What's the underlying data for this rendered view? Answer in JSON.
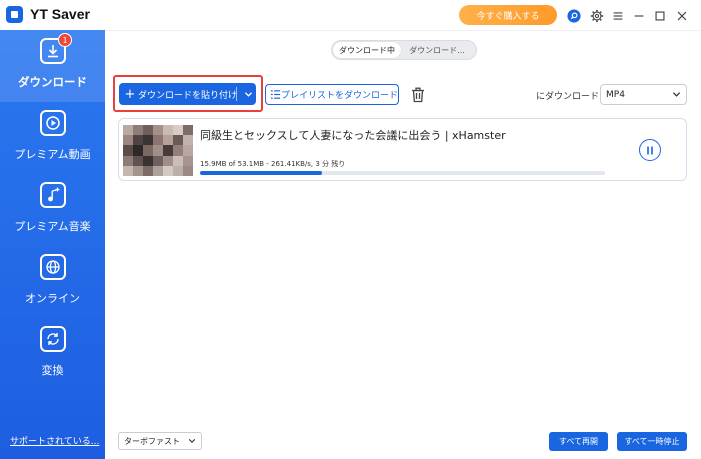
{
  "app": {
    "title": "YT Saver"
  },
  "titlebar": {
    "buy_label": "今すぐ購入する"
  },
  "sidebar": {
    "badge_count": "1",
    "items": [
      {
        "label": "ダウンロード",
        "icon": "download-icon"
      },
      {
        "label": "プレミアム動画",
        "icon": "play-icon"
      },
      {
        "label": "プレミアム音楽",
        "icon": "music-note-icon"
      },
      {
        "label": "オンライン",
        "icon": "globe-icon"
      },
      {
        "label": "変換",
        "icon": "convert-icon"
      }
    ],
    "support_label": "サポートされている..."
  },
  "tabs": {
    "downloading": "ダウンロード中",
    "downloaded": "ダウンロード..."
  },
  "toolbar": {
    "paste_label": "ダウンロードを貼り付け",
    "playlist_label": "プレイリストをダウンロード",
    "format_label": "にダウンロード",
    "format_value": "MP4"
  },
  "downloads": [
    {
      "title": "同級生とセックスして人妻になった会議に出会う | xHamster",
      "progress_text": "15.9MB of 53.1MB - 261.41KB/s, 3 分 残り",
      "progress": 0.3
    }
  ],
  "footer": {
    "speed_mode": "ターボファスト",
    "resume_all": "すべて再開",
    "pause_all": "すべて一時停止"
  },
  "colors": {
    "accent": "#1a66e0",
    "highlight": "#e8403a",
    "buy": "#ff9a2a"
  }
}
